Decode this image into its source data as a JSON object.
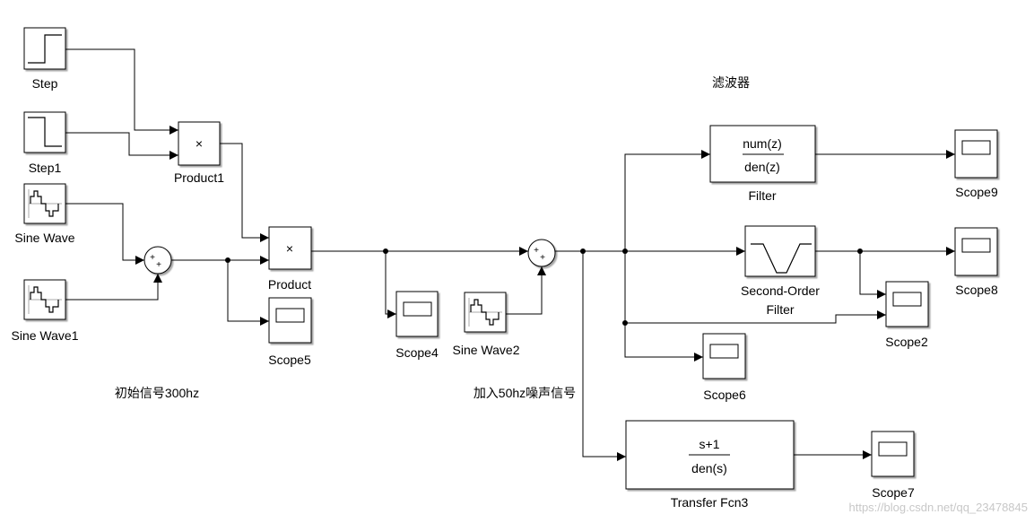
{
  "annotations": {
    "filter_group": "滤波器",
    "original_signal": "初始信号300hz",
    "noise_added": "加入50hz噪声信号"
  },
  "blocks": {
    "step": "Step",
    "step1": "Step1",
    "sine_wave": "Sine Wave",
    "sine_wave1": "Sine Wave1",
    "sine_wave2": "Sine Wave2",
    "product1": "Product1",
    "product": "Product",
    "product_symbol": "×",
    "sum_signs": "+ +",
    "scope5": "Scope5",
    "scope4": "Scope4",
    "scope6": "Scope6",
    "scope2": "Scope2",
    "scope8": "Scope8",
    "scope9": "Scope9",
    "scope7": "Scope7",
    "filter": "Filter",
    "filter_num": "num(z)",
    "filter_den": "den(z)",
    "sof_line1": "Second-Order",
    "sof_line2": "Filter",
    "tf": "Transfer Fcn3",
    "tf_num": "s+1",
    "tf_den": "den(s)"
  },
  "watermark": "https://blog.csdn.net/qq_23478845"
}
